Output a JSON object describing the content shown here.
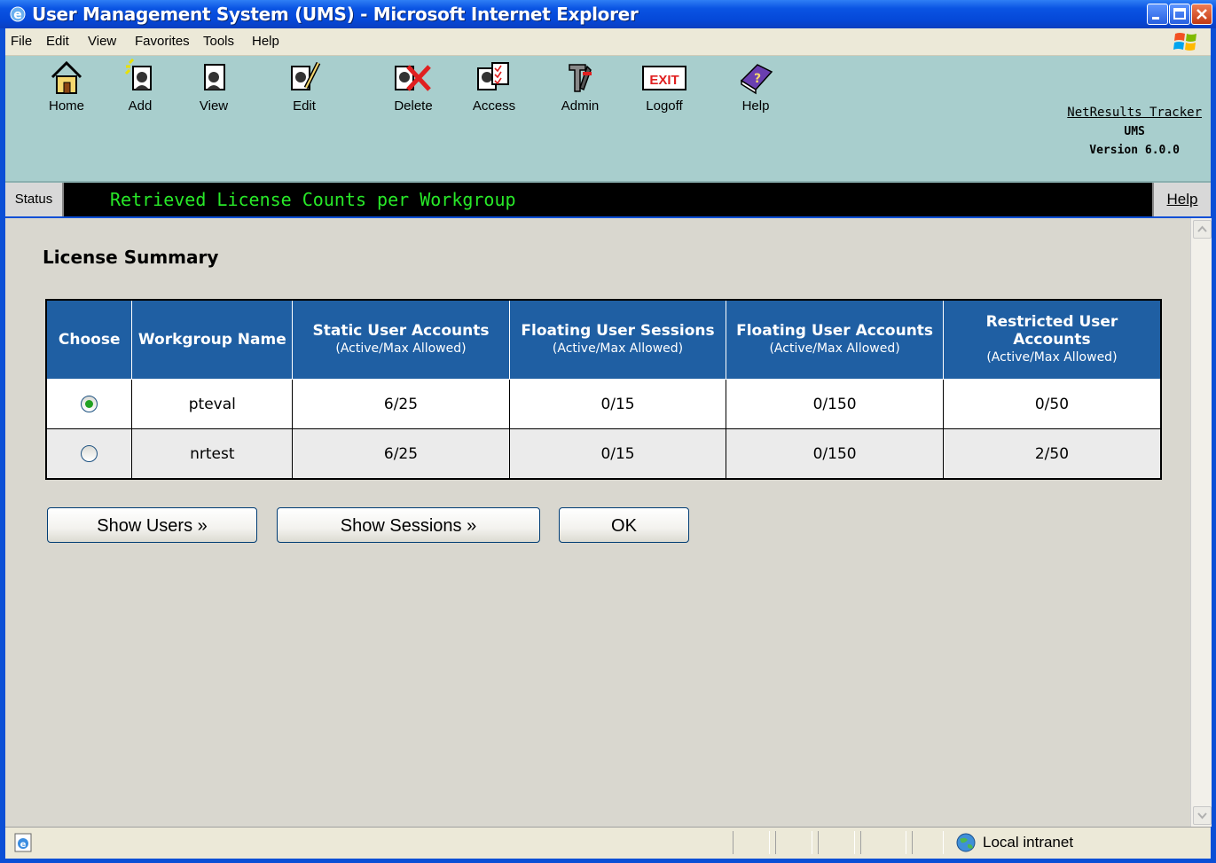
{
  "window": {
    "title": "User Management System (UMS) - Microsoft Internet Explorer"
  },
  "menu": [
    "File",
    "Edit",
    "View",
    "Favorites",
    "Tools",
    "Help"
  ],
  "toolbar": {
    "buttons": [
      {
        "label": "Home",
        "icon": "home-icon"
      },
      {
        "label": "Add",
        "icon": "add-user-icon"
      },
      {
        "label": "View",
        "icon": "view-user-icon"
      },
      {
        "label": "Edit",
        "icon": "edit-user-icon"
      },
      {
        "label": "Delete",
        "icon": "delete-user-icon"
      },
      {
        "label": "Access",
        "icon": "access-user-icon"
      },
      {
        "label": "Admin",
        "icon": "admin-tools-icon"
      },
      {
        "label": "Logoff",
        "icon": "exit-icon"
      },
      {
        "label": "Help",
        "icon": "help-book-icon"
      }
    ],
    "exit_text": "EXIT",
    "brand": {
      "link": "NetResults Tracker",
      "product": "UMS",
      "version": "Version 6.0.0"
    }
  },
  "status": {
    "label": "Status",
    "message": "Retrieved License Counts per Workgroup",
    "help": "Help"
  },
  "page": {
    "heading": "License Summary",
    "table": {
      "headers": [
        {
          "title": "Choose",
          "sub": ""
        },
        {
          "title": "Workgroup Name",
          "sub": ""
        },
        {
          "title": "Static User Accounts",
          "sub": "(Active/Max Allowed)"
        },
        {
          "title": "Floating User Sessions",
          "sub": "(Active/Max Allowed)"
        },
        {
          "title": "Floating User Accounts",
          "sub": "(Active/Max Allowed)"
        },
        {
          "title": "Restricted User Accounts",
          "sub": "(Active/Max Allowed)"
        }
      ],
      "rows": [
        {
          "selected": true,
          "workgroup": "pteval",
          "static": "6/25",
          "float_sessions": "0/15",
          "float_accounts": "0/150",
          "restricted": "0/50"
        },
        {
          "selected": false,
          "workgroup": "nrtest",
          "static": "6/25",
          "float_sessions": "0/15",
          "float_accounts": "0/150",
          "restricted": "2/50"
        }
      ]
    },
    "buttons": {
      "show_users": "Show Users »",
      "show_sessions": "Show Sessions »",
      "ok": "OK"
    }
  },
  "statusbar": {
    "zone": "Local intranet"
  },
  "colors": {
    "title_blue": "#0a54e3",
    "toolbar_teal": "#a8cecd",
    "status_green": "#28e828",
    "header_blue": "#1f5fa3",
    "content_gray": "#d9d7cf"
  }
}
